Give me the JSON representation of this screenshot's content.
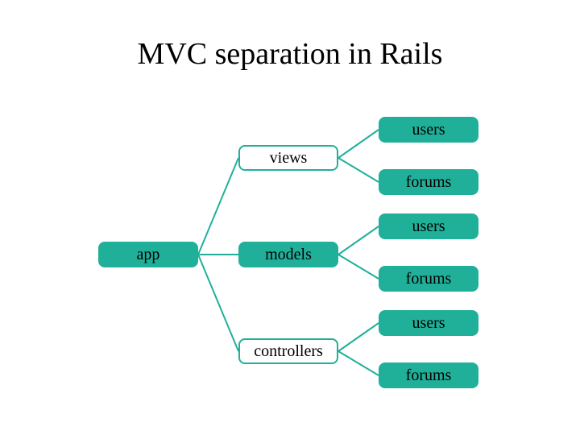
{
  "title": "MVC separation in Rails",
  "nodes": {
    "app": "app",
    "views": "views",
    "models": "models",
    "controllers": "controllers",
    "views_users": "users",
    "views_forums": "forums",
    "models_users": "users",
    "models_forums": "forums",
    "controllers_users": "users",
    "controllers_forums": "forums"
  },
  "chart_data": {
    "type": "tree",
    "title": "MVC separation in Rails",
    "root": {
      "label": "app",
      "children": [
        {
          "label": "views",
          "children": [
            {
              "label": "users"
            },
            {
              "label": "forums"
            }
          ]
        },
        {
          "label": "models",
          "children": [
            {
              "label": "users"
            },
            {
              "label": "forums"
            }
          ]
        },
        {
          "label": "controllers",
          "children": [
            {
              "label": "users"
            },
            {
              "label": "forums"
            }
          ]
        }
      ]
    }
  }
}
